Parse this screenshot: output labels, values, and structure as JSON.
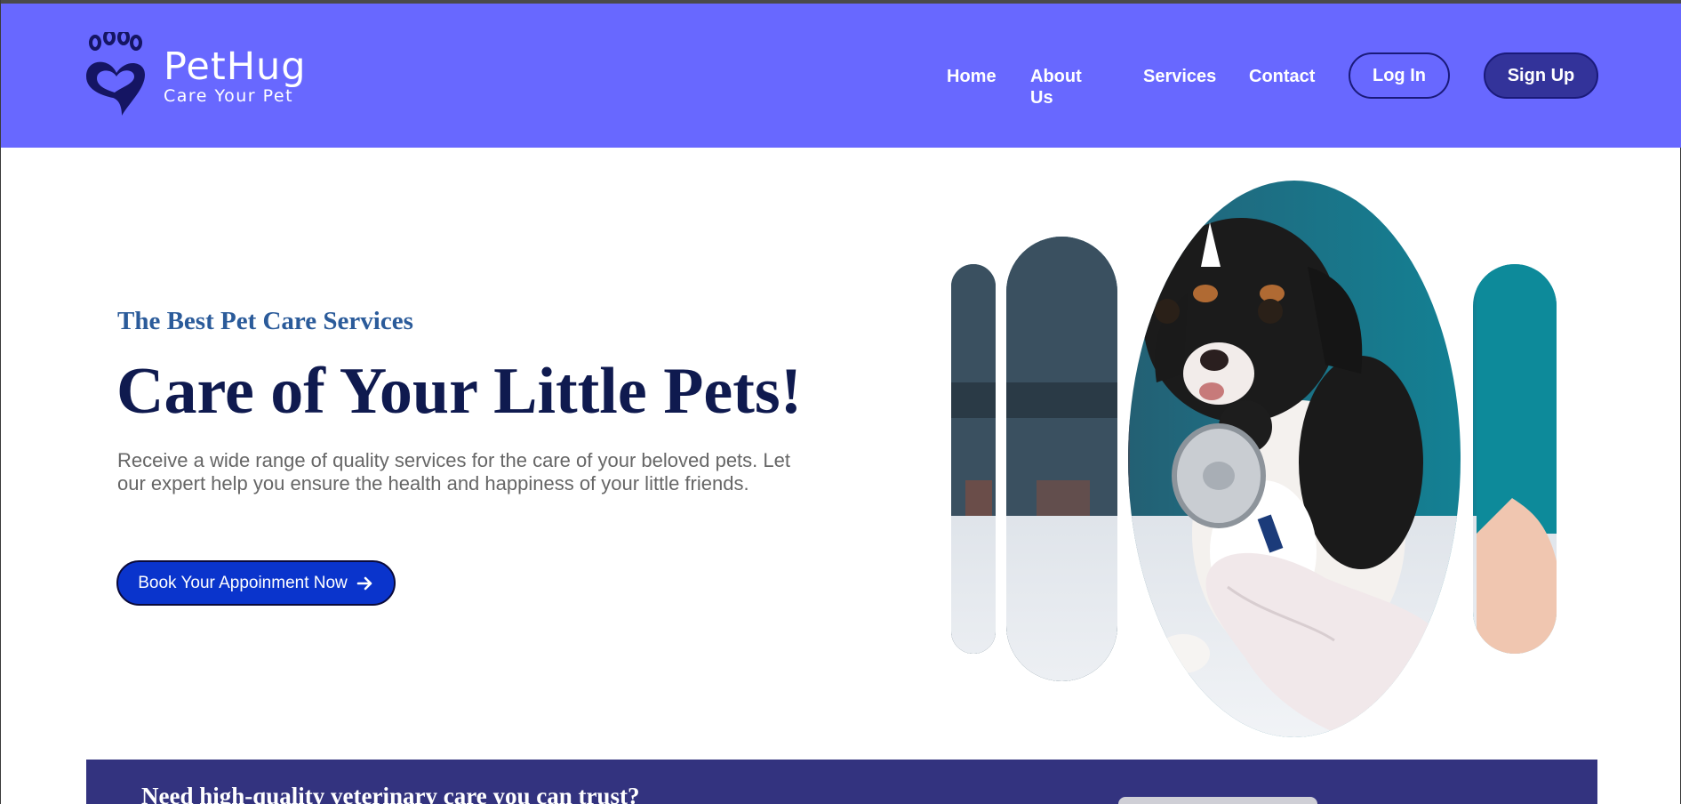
{
  "brand": {
    "name": "PetHug",
    "tagline": "Care Your Pet",
    "logo_icon": "paw-heart-icon"
  },
  "nav": {
    "items": [
      {
        "label": "Home"
      },
      {
        "label": "About Us"
      },
      {
        "label": "Services"
      },
      {
        "label": "Contact"
      }
    ],
    "login_label": "Log In",
    "signup_label": "Sign Up"
  },
  "hero": {
    "subtitle": "The Best Pet Care Services",
    "title": "Care of Your Little Pets!",
    "description": "Receive a wide range of quality services for the care of your beloved pets. Let our expert help you ensure the health and happiness of your little friends.",
    "cta_label": "Book Your Appoinment Now",
    "cta_icon": "arrow-right-icon",
    "image_subject": "puppy-with-stethoscope"
  },
  "banner": {
    "text": "Need high-quality veterinary care you can trust?"
  },
  "colors": {
    "header_bg": "#6868ff",
    "signup_bg": "#33339a",
    "cta_bg": "#0a34cc",
    "title": "#0f1a4f",
    "subtitle": "#2b5b9a",
    "banner_bg": "#33337f"
  }
}
